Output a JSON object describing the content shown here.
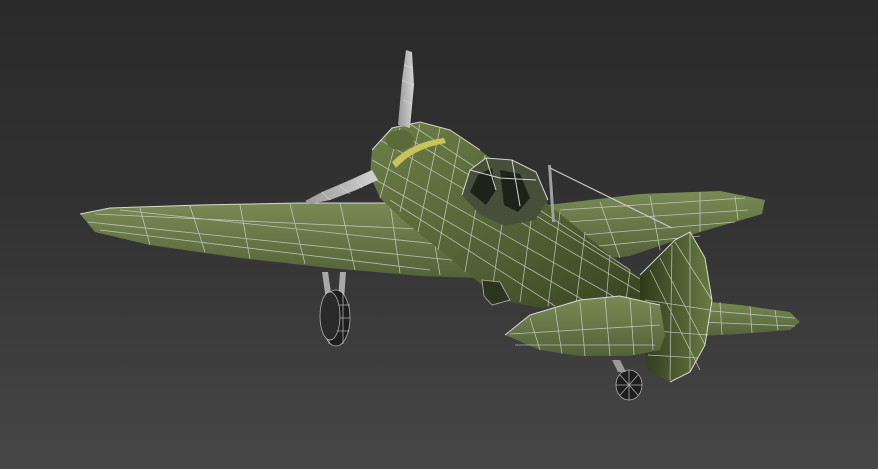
{
  "scene": {
    "subject": "3d-aircraft-wireframe-model",
    "colors": {
      "background_top": "#2a2a2a",
      "background_bottom": "#474747",
      "body_green": "#5d6e3e",
      "body_green_dark": "#3f4d28",
      "body_green_light": "#7a8a55",
      "wire": "#d9d9d9",
      "propeller": "#b8b8b8",
      "band_yellow": "#c9c45a"
    },
    "shading": "smooth-with-wireframe-overlay"
  }
}
